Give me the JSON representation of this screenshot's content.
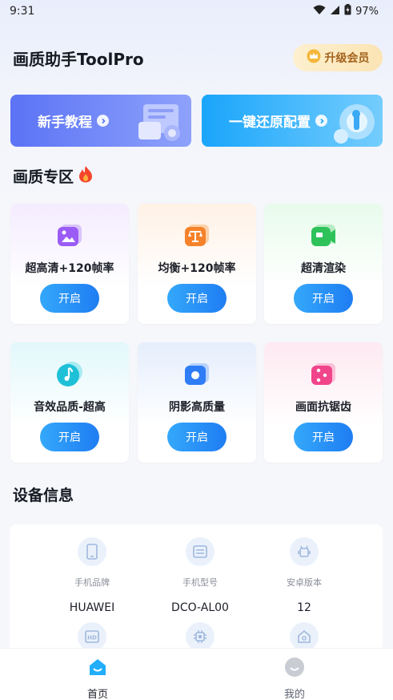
{
  "status_bar": {
    "time": "9:31",
    "battery": "97%"
  },
  "header": {
    "title": "画质助手ToolPro",
    "vip_label": "升级会员"
  },
  "banners": [
    {
      "label": "新手教程",
      "color": "#5b73f5"
    },
    {
      "label": "一键还原配置",
      "color": "#1aa5fb"
    }
  ],
  "quality_section": {
    "title": "画质专区",
    "icon": "fire-icon"
  },
  "cards": [
    {
      "label": "超高清+120帧率",
      "button": "开启",
      "icon": "image-icon",
      "accent": "#9b5cf5"
    },
    {
      "label": "均衡+120帧率",
      "button": "开启",
      "icon": "balance-icon",
      "accent": "#f5822a"
    },
    {
      "label": "超清渲染",
      "button": "开启",
      "icon": "video-camera-icon",
      "accent": "#2fc25b"
    },
    {
      "label": "音效品质-超高",
      "button": "开启",
      "icon": "music-note-icon",
      "accent": "#1ec0d8"
    },
    {
      "label": "阴影高质量",
      "button": "开启",
      "icon": "shadow-icon",
      "accent": "#2f7df6"
    },
    {
      "label": "画面抗锯齿",
      "button": "开启",
      "icon": "dice-icon",
      "accent": "#f0458a"
    }
  ],
  "device_section": {
    "title": "设备信息",
    "items": [
      {
        "label": "手机品牌",
        "value": "HUAWEI",
        "icon": "phone-icon"
      },
      {
        "label": "手机型号",
        "value": "DCO-AL00",
        "icon": "model-card-icon"
      },
      {
        "label": "安卓版本",
        "value": "12",
        "icon": "android-icon"
      },
      {
        "label": "",
        "value": "",
        "icon": "hd-icon"
      },
      {
        "label": "",
        "value": "",
        "icon": "chip-icon"
      },
      {
        "label": "",
        "value": "",
        "icon": "storage-icon"
      }
    ]
  },
  "bottom_nav": [
    {
      "label": "首页",
      "active": true,
      "icon": "home-icon"
    },
    {
      "label": "我的",
      "active": false,
      "icon": "profile-icon"
    }
  ]
}
